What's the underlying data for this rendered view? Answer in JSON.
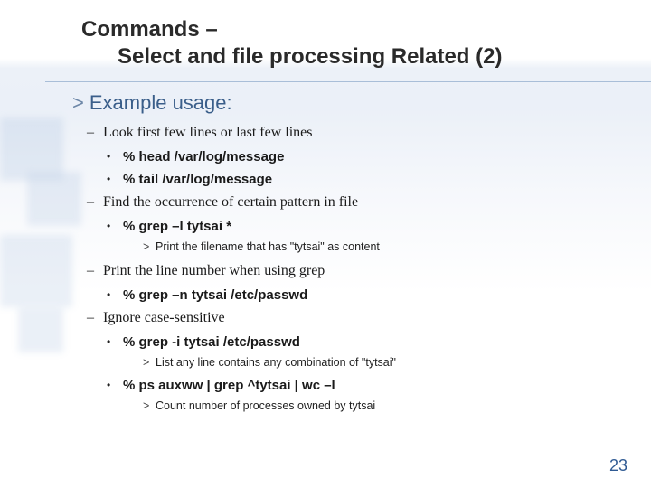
{
  "title": {
    "line1": "Commands –",
    "line2": "Select and file processing Related (2)"
  },
  "section_heading": "Example usage:",
  "items": {
    "group1": {
      "label": "Look first few lines or last few lines",
      "cmd1": "% head /var/log/message",
      "cmd2": "% tail /var/log/message"
    },
    "group2": {
      "label": "Find the occurrence of certain pattern in file",
      "cmd1": "% grep –l tytsai *",
      "note1": "Print the filename that has \"tytsai\" as content"
    },
    "group3": {
      "label": "Print the line number when using grep",
      "cmd1": "% grep –n tytsai /etc/passwd"
    },
    "group4": {
      "label": "Ignore case-sensitive",
      "cmd1": "% grep -i tytsai /etc/passwd",
      "note1": "List any line contains any combination of \"tytsai\"",
      "cmd2": "% ps auxww | grep ^tytsai | wc –l",
      "note2": "Count number of processes owned by tytsai"
    }
  },
  "page_number": "23"
}
